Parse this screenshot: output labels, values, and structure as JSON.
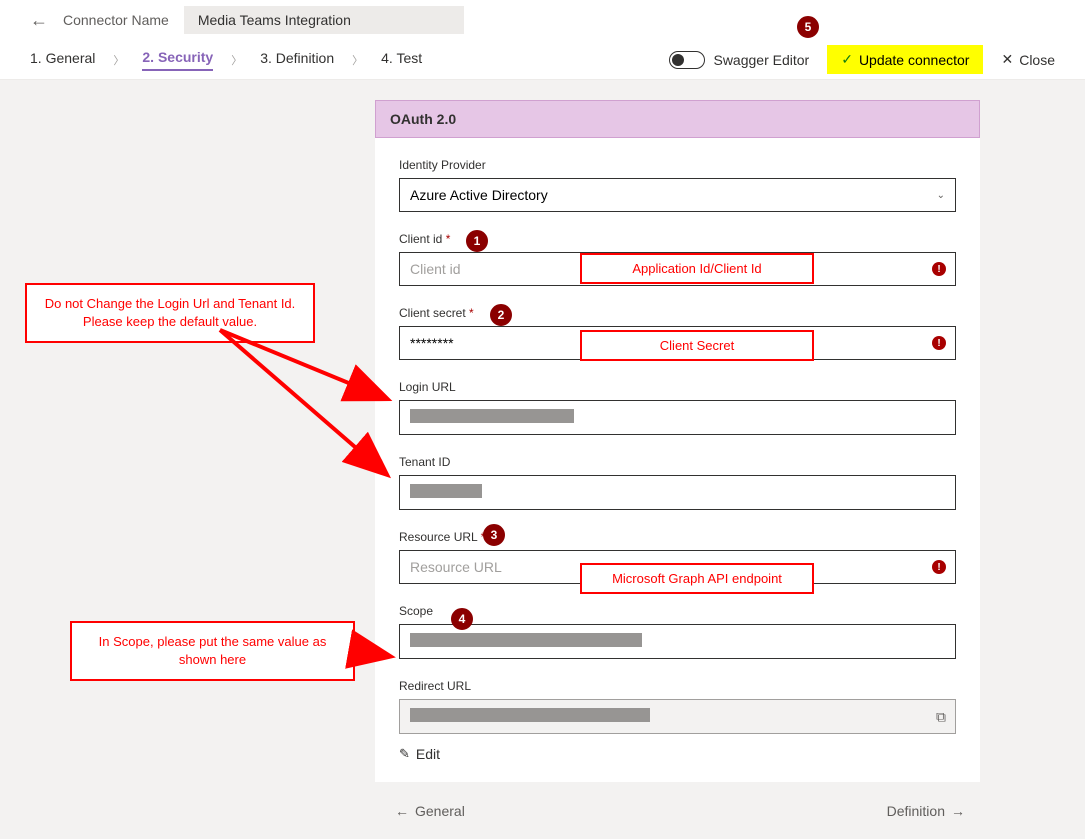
{
  "header": {
    "connector_label": "Connector Name",
    "connector_name": "Media Teams Integration"
  },
  "tabs": {
    "general": "1. General",
    "security": "2. Security",
    "definition": "3. Definition",
    "test": "4. Test"
  },
  "actions": {
    "swagger": "Swagger Editor",
    "update": "Update connector",
    "close": "Close"
  },
  "card": {
    "title": "OAuth 2.0",
    "identity_provider_label": "Identity Provider",
    "identity_provider_value": "Azure Active Directory",
    "client_id_label": "Client id",
    "client_id_placeholder": "Client id",
    "client_secret_label": "Client secret",
    "client_secret_value": "********",
    "login_url_label": "Login URL",
    "tenant_id_label": "Tenant ID",
    "resource_url_label": "Resource URL",
    "resource_url_placeholder": "Resource URL",
    "scope_label": "Scope",
    "redirect_url_label": "Redirect URL",
    "edit": "Edit"
  },
  "callouts": {
    "no_change": "Do not Change the Login Url and Tenant Id. Please keep the default value.",
    "scope_note": "In Scope, please put the same value as shown here",
    "app_id": "Application Id/Client Id",
    "client_secret": "Client Secret",
    "graph": "Microsoft Graph API endpoint"
  },
  "badges": {
    "b1": "1",
    "b2": "2",
    "b3": "3",
    "b4": "4",
    "b5": "5"
  },
  "bottom": {
    "prev": "General",
    "next": "Definition"
  }
}
